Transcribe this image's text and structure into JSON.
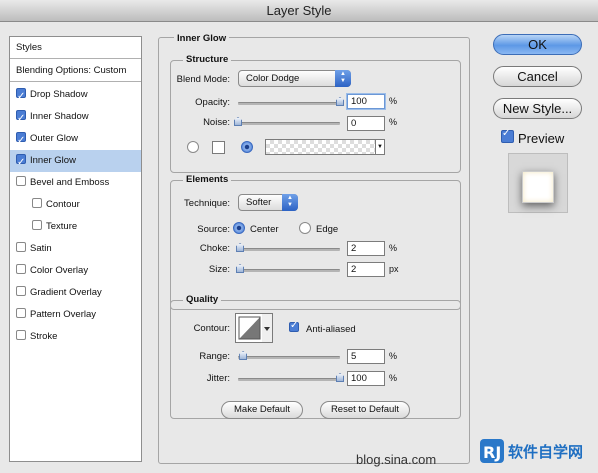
{
  "window": {
    "title": "Layer Style"
  },
  "styles_panel": {
    "header": "Styles",
    "blending": "Blending Options: Custom",
    "items": [
      {
        "label": "Drop Shadow",
        "checked": true,
        "selected": false,
        "indent": false
      },
      {
        "label": "Inner Shadow",
        "checked": true,
        "selected": false,
        "indent": false
      },
      {
        "label": "Outer Glow",
        "checked": true,
        "selected": false,
        "indent": false
      },
      {
        "label": "Inner Glow",
        "checked": true,
        "selected": true,
        "indent": false
      },
      {
        "label": "Bevel and Emboss",
        "checked": false,
        "selected": false,
        "indent": false
      },
      {
        "label": "Contour",
        "checked": false,
        "selected": false,
        "indent": true
      },
      {
        "label": "Texture",
        "checked": false,
        "selected": false,
        "indent": true
      },
      {
        "label": "Satin",
        "checked": false,
        "selected": false,
        "indent": false
      },
      {
        "label": "Color Overlay",
        "checked": false,
        "selected": false,
        "indent": false
      },
      {
        "label": "Gradient Overlay",
        "checked": false,
        "selected": false,
        "indent": false
      },
      {
        "label": "Pattern Overlay",
        "checked": false,
        "selected": false,
        "indent": false
      },
      {
        "label": "Stroke",
        "checked": false,
        "selected": false,
        "indent": false
      }
    ]
  },
  "inner_glow": {
    "title": "Inner Glow",
    "structure": {
      "title": "Structure",
      "blend_mode_label": "Blend Mode:",
      "blend_mode": "Color Dodge",
      "opacity_label": "Opacity:",
      "opacity": "100",
      "opacity_level": 1.0,
      "noise_label": "Noise:",
      "noise": "0",
      "noise_level": 0.0,
      "unit": "%"
    },
    "elements": {
      "title": "Elements",
      "technique_label": "Technique:",
      "technique": "Softer",
      "source_label": "Source:",
      "source_center": "Center",
      "source_edge": "Edge",
      "choke_label": "Choke:",
      "choke": "2",
      "choke_level": 0.02,
      "choke_unit": "%",
      "size_label": "Size:",
      "size": "2",
      "size_unit": "px"
    },
    "quality": {
      "title": "Quality",
      "contour_label": "Contour:",
      "anti_aliased_label": "Anti-aliased",
      "anti_aliased": true,
      "range_label": "Range:",
      "range": "5",
      "range_level": 0.05,
      "jitter_label": "Jitter:",
      "jitter": "100",
      "jitter_level": 1.0,
      "unit": "%"
    },
    "make_default": "Make Default",
    "reset_default": "Reset to Default"
  },
  "actions": {
    "ok": "OK",
    "cancel": "Cancel",
    "new_style": "New Style...",
    "preview_label": "Preview",
    "preview_checked": true
  },
  "watermark": {
    "text": "blog.sina.com",
    "logo_text": "软件自学网"
  },
  "colors": {
    "accent": "#4b7dd4",
    "selection": "#b9d1ee",
    "primary_button": "#5d98e6"
  }
}
